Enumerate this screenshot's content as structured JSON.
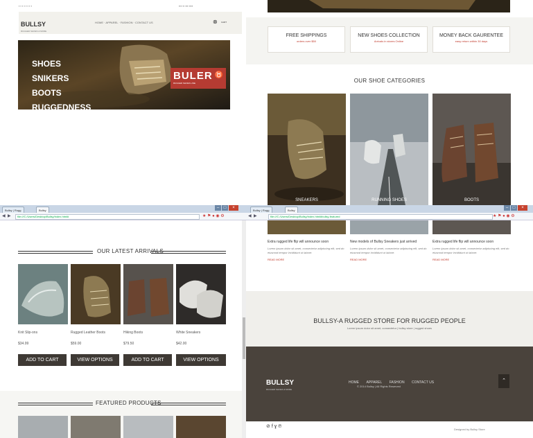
{
  "top_left": {
    "header": {
      "logo": "BULLSY",
      "logo_tag": "RUGGED SHOES & MORE",
      "nav": [
        "HOME",
        "APPAREL",
        "FASHION",
        "CONTACT US"
      ],
      "cart_badge": "CART"
    },
    "hero": {
      "menu": [
        "SHOES",
        "SNIKERS",
        "BOOTS",
        "RUGGEDNESS"
      ],
      "brand": "BULER",
      "brand_tag": "RUGGED SHOES LINE"
    }
  },
  "top_right": {
    "features": [
      {
        "title": "FREE SHIPPINGS",
        "sub": "orders over $50"
      },
      {
        "title": "NEW SHOES COLLECTION",
        "sub": "Arrivals in stores Online"
      },
      {
        "title": "MONEY BACK GAURENTEE",
        "sub": "easy return within 30 days"
      }
    ],
    "categories_heading": "OUR SHOE CATEGORIES",
    "categories": [
      "SNEAKERS",
      "RUNNING SHOES",
      "BOOTS"
    ]
  },
  "bottom_left": {
    "browser": {
      "tabs": [
        "Bullsy | Rugg",
        "Bullsy"
      ],
      "address": "file:///C:/Users/Desktop/Bullsy/index.html#"
    },
    "arrivals_heading": "OUR LATEST ARRIVALS",
    "products": [
      {
        "name": "Knit Slip-ons",
        "price": "$34.99",
        "button": "ADD TO CART"
      },
      {
        "name": "Rugged Leather Boots",
        "price": "$59.00",
        "button": "VIEW OPTIONS"
      },
      {
        "name": "Hiking Boots",
        "price": "$79.50",
        "button": "ADD TO CART"
      },
      {
        "name": "White Sneakers",
        "price": "$42.00",
        "button": "VIEW OPTIONS"
      }
    ],
    "featured_heading": "FEATURED PRODUCTS"
  },
  "bottom_right": {
    "browser": {
      "tabs": [
        "Bullsy | Rugg",
        "Bullsy"
      ],
      "address": "file:///C:/Users/Desktop/Bullsy/index.html#bullsy-featured"
    },
    "posts": [
      {
        "title": "Extra rugged life flip will announce soon",
        "excerpt": "Lorem ipsum dolor sit amet, consectetur adipiscing elit, sed do eiusmod tempor incididunt ut labore.",
        "more": "READ MORE"
      },
      {
        "title": "New models of Bullsy Sneakers just arrived",
        "excerpt": "Lorem ipsum dolor sit amet, consectetur adipiscing elit, sed do eiusmod tempor incididunt ut labore.",
        "more": "READ MORE"
      },
      {
        "title": "Extra rugged life flip will announce soon",
        "excerpt": "Lorem ipsum dolor sit amet, consectetur adipiscing elit, sed do eiusmod tempor incididunt ut labore.",
        "more": "READ MORE"
      }
    ],
    "tagline": "BULLSY-A RUGGED STORE FOR RUGGED PEOPLE",
    "tagline_sub": "Lorem ipsum dolor sit amet, consectetur | bullsy store | rugged shoes",
    "footer": {
      "logo": "BULLSY",
      "logo_tag": "RUGGED SHOES & MORE",
      "links": [
        "HOME",
        "APPAREL",
        "FASHION",
        "CONTACT US"
      ],
      "copyright": "© 2014 Bullsy | All Rights Reserved",
      "credit": "Designed by Bullsy Store",
      "social": [
        "rss",
        "facebook",
        "twitter",
        "pinterest"
      ]
    }
  },
  "colors": {
    "dark": "#3e3934",
    "footer": "#4a433c",
    "accent_red": "#c0392b",
    "header_bg": "#f2f1ec",
    "feature_bg": "#f4f4f1"
  }
}
